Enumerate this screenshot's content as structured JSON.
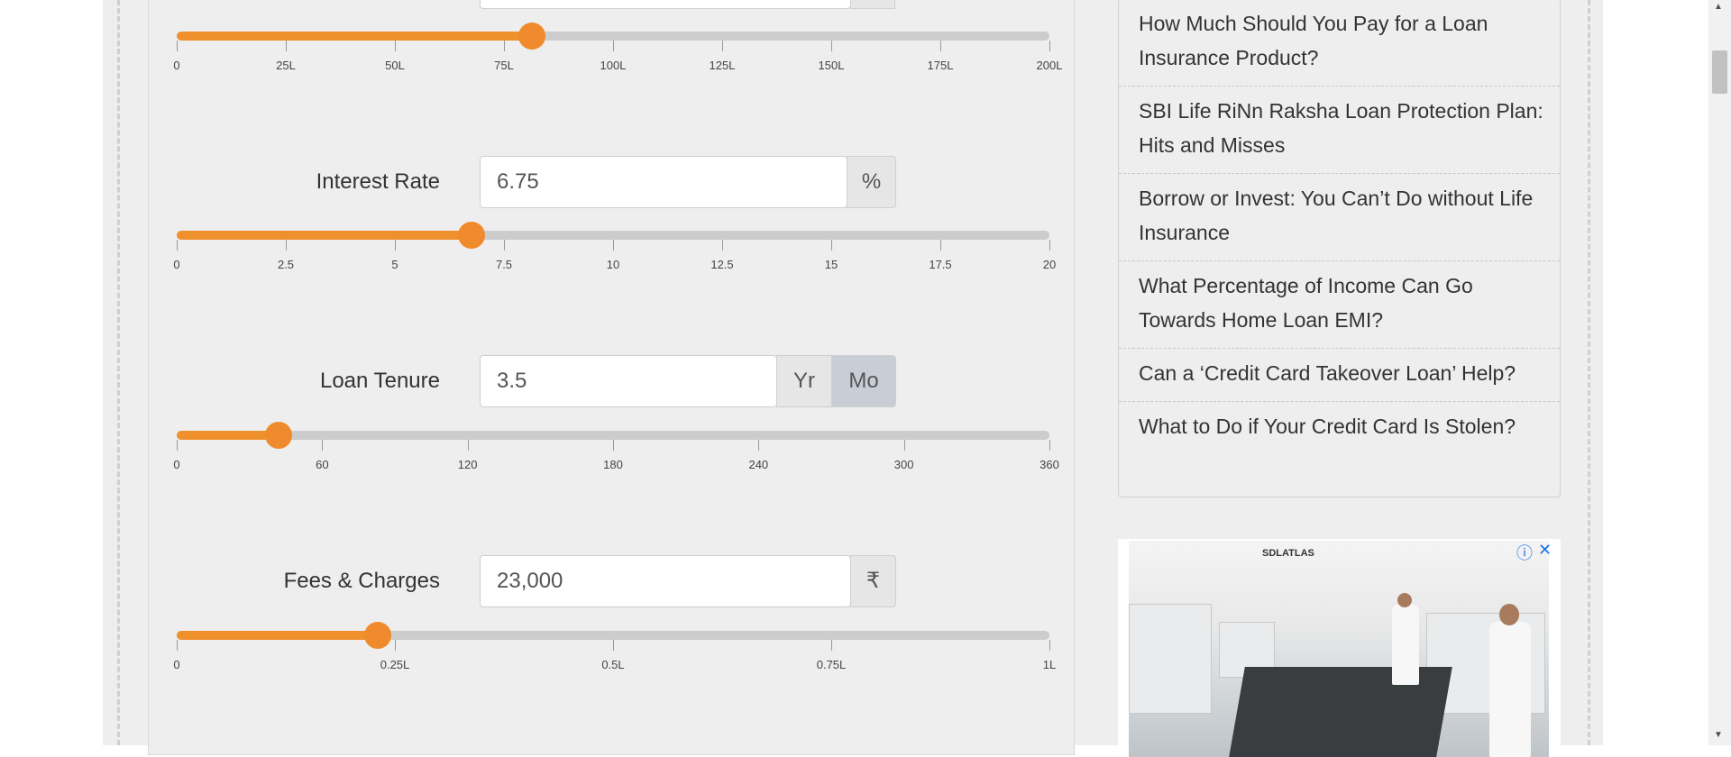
{
  "loan_amount": {
    "value_fraction": 0.407,
    "ticks": [
      "0",
      "25L",
      "50L",
      "75L",
      "100L",
      "125L",
      "150L",
      "175L",
      "200L"
    ]
  },
  "interest_rate": {
    "label": "Interest Rate",
    "value": "6.75",
    "unit": "%",
    "value_fraction": 0.3375,
    "ticks": [
      "0",
      "2.5",
      "5",
      "7.5",
      "10",
      "12.5",
      "15",
      "17.5",
      "20"
    ]
  },
  "loan_tenure": {
    "label": "Loan Tenure",
    "value": "3.5",
    "unit_year": "Yr",
    "unit_month": "Mo",
    "value_fraction": 0.1167,
    "ticks": [
      "0",
      "60",
      "120",
      "180",
      "240",
      "300",
      "360"
    ]
  },
  "fees_charges": {
    "label": "Fees & Charges",
    "value": "23,000",
    "unit": "₹",
    "value_fraction": 0.23,
    "ticks": [
      "0",
      "0.25L",
      "0.5L",
      "0.75L",
      "1L"
    ]
  },
  "sidebar": {
    "articles": [
      {
        "title": "How Much Should You Pay for a Loan Insurance Product?"
      },
      {
        "title": "SBI Life RiNn Raksha Loan Protection Plan: Hits and Misses"
      },
      {
        "title": "Borrow or Invest: You Can’t Do without Life Insurance"
      },
      {
        "title": "What Percentage of Income Can Go Towards Home Loan EMI?"
      },
      {
        "title": "Can a ‘Credit Card Takeover Loan’ Help?"
      },
      {
        "title": "What to Do if Your Credit Card Is Stolen?"
      }
    ]
  },
  "ad": {
    "brand": "SDLATLAS",
    "info_icon": "info-icon",
    "close_icon": "close-icon"
  },
  "colors": {
    "accent": "#f0902d",
    "track": "#cccccc"
  }
}
